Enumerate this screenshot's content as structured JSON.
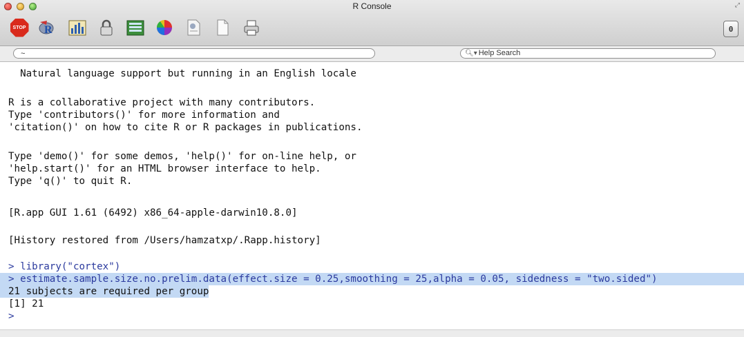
{
  "window": {
    "title": "R Console"
  },
  "toolbar": {
    "stop_label": "STOP",
    "buttons": [
      {
        "name": "stop-icon"
      },
      {
        "name": "source-script-icon"
      },
      {
        "name": "quartz-chart-icon"
      },
      {
        "name": "lock-icon"
      },
      {
        "name": "package-browser-icon"
      },
      {
        "name": "color-wheel-icon"
      },
      {
        "name": "open-document-icon"
      },
      {
        "name": "new-document-icon"
      },
      {
        "name": "printer-icon"
      }
    ],
    "drawer_label": "0"
  },
  "pathbar": {
    "value": "~"
  },
  "search": {
    "placeholder": "Help Search"
  },
  "console": {
    "lines": [
      "  Natural language support but running in an English locale",
      "",
      "R is a collaborative project with many contributors.",
      "Type 'contributors()' for more information and",
      "'citation()' on how to cite R or R packages in publications.",
      "",
      "Type 'demo()' for some demos, 'help()' for on-line help, or",
      "'help.start()' for an HTML browser interface to help.",
      "Type 'q()' to quit R.",
      "",
      "[R.app GUI 1.61 (6492) x86_64-apple-darwin10.8.0]",
      "",
      "[History restored from /Users/hamzatxp/.Rapp.history]",
      ""
    ],
    "cmd1": "> library(\"cortex\")",
    "cmd2": "> estimate.sample.size.no.prelim.data(effect.size = 0.25,smoothing = 25,alpha = 0.05, sidedness = \"two.sided\")",
    "out1": "21 subjects are required per group",
    "out2": "[1] 21",
    "prompt": ">"
  },
  "colors": {
    "selection": "#c3d9f4",
    "prompt": "#2b3a9e",
    "stop": "#d92a1c"
  }
}
